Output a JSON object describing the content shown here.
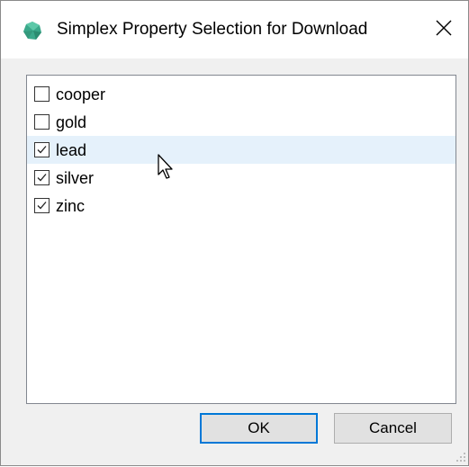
{
  "window": {
    "title": "Simplex Property Selection for Download",
    "icon": "app-gem-icon",
    "close_icon": "close-icon"
  },
  "list": {
    "items": [
      {
        "label": "cooper",
        "checked": false
      },
      {
        "label": "gold",
        "checked": false
      },
      {
        "label": "lead",
        "checked": true,
        "hover": true
      },
      {
        "label": "silver",
        "checked": true
      },
      {
        "label": "zinc",
        "checked": true
      }
    ]
  },
  "buttons": {
    "ok_label": "OK",
    "cancel_label": "Cancel"
  },
  "colors": {
    "accent": "#0078d7",
    "hover_row": "#e5f1fb",
    "icon_teal": "#3aa88a"
  }
}
